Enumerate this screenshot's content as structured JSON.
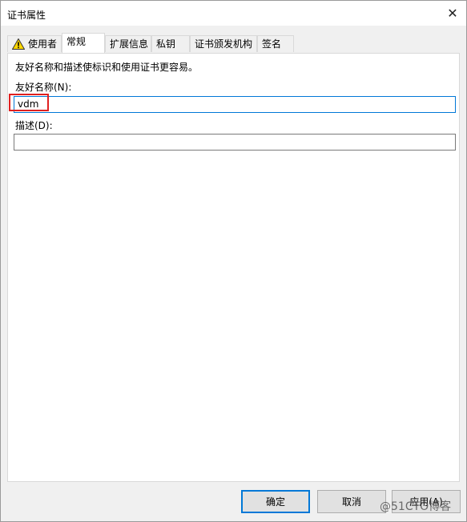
{
  "window": {
    "title": "证书属性",
    "close_symbol": "✕"
  },
  "tabs": [
    {
      "label": "使用者"
    },
    {
      "label": "常规"
    },
    {
      "label": "扩展信息"
    },
    {
      "label": "私钥"
    },
    {
      "label": "证书颁发机构"
    },
    {
      "label": "签名"
    }
  ],
  "active_tab": "常规",
  "general": {
    "description": "友好名称和描述使标识和使用证书更容易。",
    "friendly_name_label": "友好名称(N):",
    "friendly_name_value": "vdm",
    "description_label": "描述(D):",
    "description_value": ""
  },
  "buttons": {
    "ok": "确定",
    "cancel": "取消",
    "apply": "应用(A)"
  },
  "watermark": "@51CTO博客",
  "colors": {
    "highlight": "#e02020",
    "focus": "#0078d7",
    "warning": "#ffd700"
  }
}
